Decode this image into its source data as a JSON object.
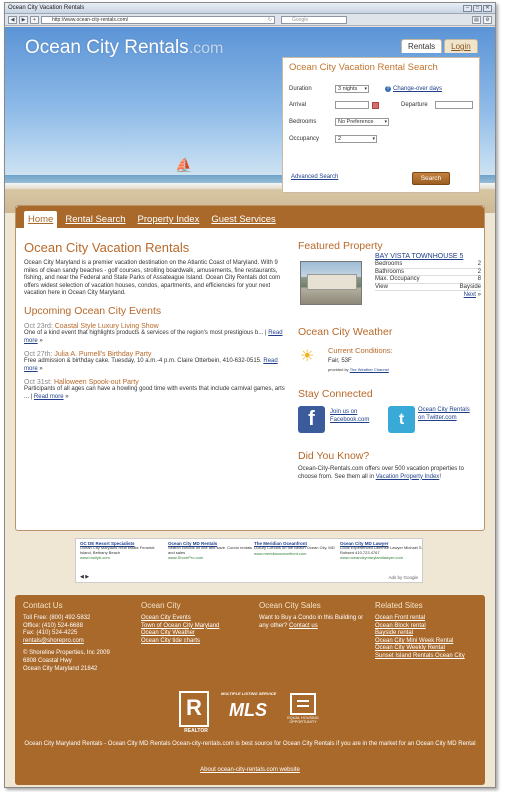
{
  "browser": {
    "window_title": "Ocean City Vacation Rentals",
    "url": "http://www.ocean-city-rentals.com/",
    "search_placeholder": "Google"
  },
  "header": {
    "logo_main": "Ocean City Rentals",
    "logo_suffix": ".com",
    "tab_rentals": "Rentals",
    "tab_login": "Login"
  },
  "search": {
    "title": "Ocean City Vacation Rental Search",
    "duration_label": "Duration",
    "duration_value": "3 nights",
    "changeover_link": "Change-over days",
    "arrival_label": "Arrival",
    "departure_label": "Departure",
    "bedrooms_label": "Bedrooms",
    "bedrooms_value": "No Preference",
    "occupancy_label": "Occupancy",
    "occupancy_value": "2",
    "advanced_link": "Advanced Search",
    "search_button": "Search"
  },
  "nav": {
    "home": "Home",
    "rental_search": "Rental Search",
    "property_index": "Property Index",
    "guest_services": "Guest Services"
  },
  "main": {
    "title": "Ocean City Vacation Rentals",
    "intro": "Ocean City Maryland is a premier vacation destination on the Atlantic Coast of Maryland. With 9 miles of clean sandy beaches - golf courses, strolling boardwalk, amusements, fine restaurants, fishing, and near the Federal and State Parks of Assateague Island. Ocean City Rentals dot com offers widest selection of vacation houses, condos, apartments, and efficiencies for your next vacation here in Ocean City Maryland.",
    "events_title": "Upcoming Ocean City Events",
    "events": [
      {
        "date": "Oct 23rd:",
        "name": "Coastal Style Luxury Living Show",
        "desc": "One of a kind event that highlights products & services of the region's most prestigious b...",
        "more": "Read more"
      },
      {
        "date": "Oct 27th:",
        "name": "Julia A. Purnell's Birthday Party",
        "desc": "Free admission & birthday cake. Tuesday, 10 a.m.-4 p.m. Claire Otterbein, 410-632-0515.",
        "more": "Read more"
      },
      {
        "date": "Oct 31st:",
        "name": "Halloween Spook-out Party",
        "desc": "Participants of all ages can have a howling good time with events that include carnival games, arts ...",
        "more": "Read more"
      }
    ]
  },
  "featured": {
    "title": "Featured Property",
    "property_name": "BAY VISTA TOWNHOUSE 5",
    "rows": [
      {
        "label": "Bedrooms",
        "value": "2"
      },
      {
        "label": "Bathrooms",
        "value": "2"
      },
      {
        "label": "Max. Occupancy",
        "value": "8"
      },
      {
        "label": "View",
        "value": "Bayside"
      }
    ],
    "next": "Next"
  },
  "weather": {
    "title": "Ocean City Weather",
    "conditions_label": "Current Conditions:",
    "conditions": "Fair, 53F",
    "provided": "provided by",
    "provider": "The Weather Channel"
  },
  "social": {
    "title": "Stay Connected",
    "facebook_text": "Join us on Facebook.com",
    "twitter_text": "Ocean City Rentals on Twitter.com"
  },
  "didyouknow": {
    "title": "Did You Know?",
    "text": "Ocean-City-Rentals.com offers over 500 vacation properties to choose from. See them all in",
    "link": "Vacation Property Index",
    "end": "!"
  },
  "ads": {
    "items": [
      {
        "head": "OC DE Resort Specialists",
        "body": "Ocean City Maryland Real estate Fenwick Island, Bethany Beach",
        "url": "www.mollyb.com"
      },
      {
        "head": "Ocean City MD Rentals",
        "body": "Search condos on line and save. Condo rentals and sales",
        "url": "www.ShorePro.com"
      },
      {
        "head": "The Meridian Oceanfront",
        "body": "Luxury Condos on the Beach Ocean City, MD",
        "url": "www.meridianoceanfront.com"
      },
      {
        "head": "Ocean City MD Lawyer",
        "body": "Local Experienced Defense Lawyer Michael S. Robsert 410.723.4767",
        "url": "www.oceancitymarylandlawyer.com"
      }
    ],
    "adsby": "Ads by Google"
  },
  "footer": {
    "contact_title": "Contact Us",
    "contact_lines": [
      "Toll Free: (800) 492-5832",
      "Office: (410) 524-6688",
      "Fax: (410) 524-4225"
    ],
    "contact_email": "rentals@shorepro.com",
    "address_lines": [
      "© Shoreline Properties, Inc 2009",
      "6808 Coastal Hwy",
      "Ocean City Maryland 21842"
    ],
    "oc_title": "Ocean City",
    "oc_links": [
      "Ocean City Events",
      "Town of Ocean City Maryland",
      "Ocean City Weather",
      "Ocean City tide charts"
    ],
    "sales_title": "Ocean City Sales",
    "sales_text": "Want to Buy a Condo in this Building or any other?",
    "sales_link": "Contact us",
    "related_title": "Related Sites",
    "related_links": [
      "Ocean Front rental",
      "Ocean Block rental",
      "Bayside rental",
      "Ocean City Mini Week Rental",
      "Ocean City Weekly Rental",
      "Sunset Island Rentals Ocean City"
    ],
    "realtor_letter": "R",
    "realtor_caption": "REALTOR",
    "mls_small": "MULTIPLE LISTING SERVICE",
    "mls_text": "MLS",
    "eho_caption": "EQUAL HOUSING OPPORTUNITY",
    "bottom_text": "Ocean City Maryland Rentals - Ocean City MD Rentals Ocean-city-rentals.com is best source for Ocean City Rentals if you are in the market for an Ocean City MD Rental",
    "about_link": "About ocean-city-rentals.com website"
  }
}
